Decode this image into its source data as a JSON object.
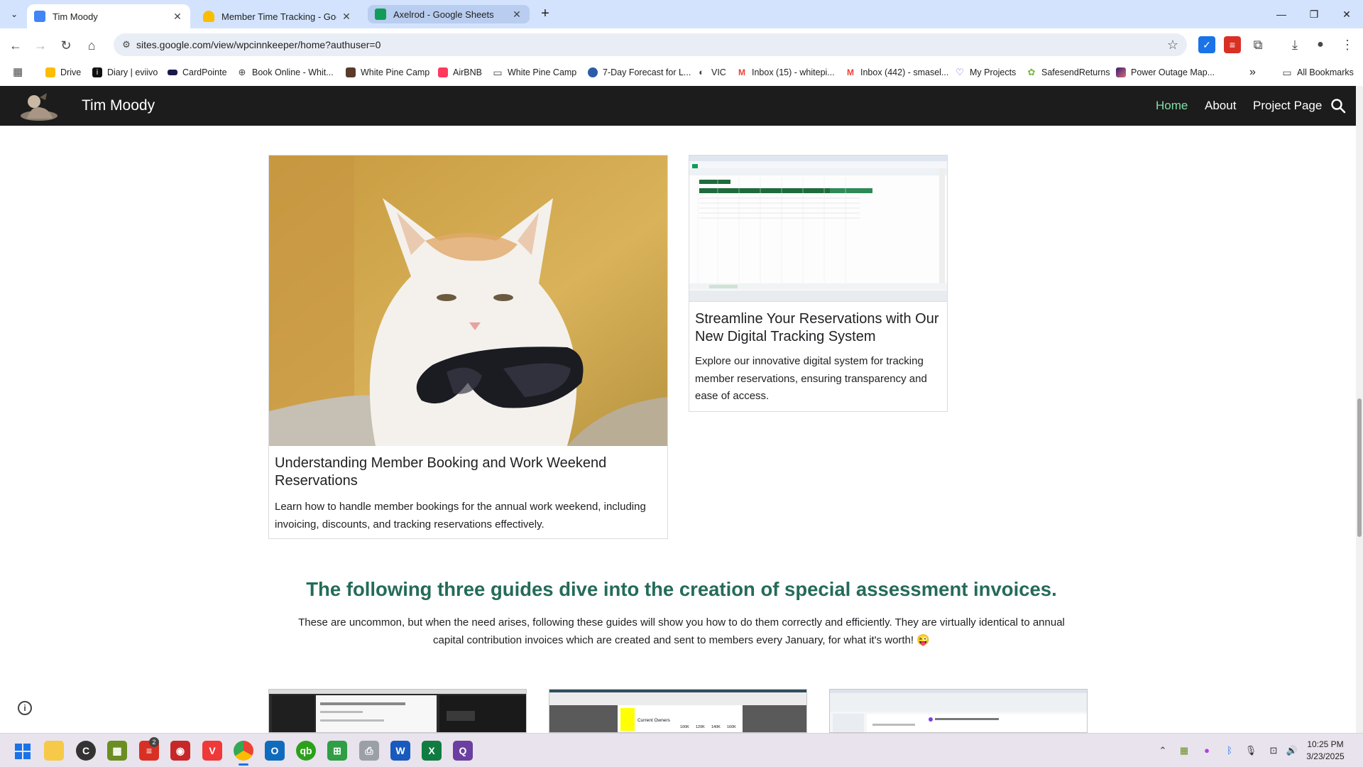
{
  "browser": {
    "tabs": [
      {
        "title": "Tim Moody",
        "favicon": "google-sites-icon",
        "color": "#4285f4"
      },
      {
        "title": "Member Time Tracking - Googl",
        "favicon": "google-drive-icon",
        "color": "#fbbc04"
      },
      {
        "title": "Axelrod - Google Sheets",
        "favicon": "google-sheets-icon",
        "color": "#0f9d58"
      }
    ],
    "new_tab_label": "+",
    "url": "sites.google.com/view/wpcinnkeeper/home?authuser=0",
    "bookmarks": [
      {
        "label": "Drive",
        "icon": "drive-icon"
      },
      {
        "label": "Diary | eviivo",
        "icon": "eviivo-icon"
      },
      {
        "label": "CardPointe",
        "icon": "card-icon"
      },
      {
        "label": "Book Online - Whit...",
        "icon": "globe-icon"
      },
      {
        "label": "White Pine Camp",
        "icon": "camp-icon"
      },
      {
        "label": "AirBNB",
        "icon": "airbnb-icon"
      },
      {
        "label": "White Pine Camp",
        "icon": "folder-icon"
      },
      {
        "label": "7-Day Forecast for L...",
        "icon": "weather-icon"
      },
      {
        "label": "VIC",
        "icon": "vic-icon"
      },
      {
        "label": "Inbox (15) - whitepi...",
        "icon": "gmail-icon"
      },
      {
        "label": "Inbox (442) - smasel...",
        "icon": "gmail-icon"
      },
      {
        "label": "My Projects",
        "icon": "heart-icon"
      },
      {
        "label": "SafesendReturns",
        "icon": "leaf-icon"
      },
      {
        "label": "Power Outage Map...",
        "icon": "map-icon"
      }
    ],
    "bookmarks_overflow": "»",
    "all_bookmarks": "All Bookmarks"
  },
  "site": {
    "title": "Tim Moody",
    "nav": [
      {
        "label": "Home",
        "active": true
      },
      {
        "label": "About",
        "active": false
      },
      {
        "label": "Project Page",
        "active": false
      }
    ],
    "accent": "#7fe0a9"
  },
  "cards": [
    {
      "title": "Understanding Member Booking and Work Weekend Reservations",
      "text": "Learn how to handle member bookings for the annual work weekend, including invoicing, discounts, and tracking reservations effectively.",
      "image": "cat-with-sunglasses"
    },
    {
      "title": "Streamline Your Reservations with Our New Digital Tracking System",
      "text": "Explore our innovative digital system for tracking member reservations, ensuring transparency and ease of access.",
      "image": "spreadsheet-screenshot"
    }
  ],
  "section": {
    "heading": "The following three guides dive into the creation of special assessment invoices.",
    "text": "These are uncommon, but when the need arises, following these guides will show you how to do them correctly and efficiently. They are virtually identical to annual capital contribution invoices which are created and sent to members every January, for what it's worth! 😜",
    "heading_color": "#256b59"
  },
  "thumb_texts": {
    "invoice_label": "Current Owners",
    "values": [
      "100K",
      "120K",
      "140K",
      "160K"
    ]
  },
  "taskbar": {
    "badge": "2",
    "time": "10:25 PM",
    "date": "3/23/2025"
  }
}
